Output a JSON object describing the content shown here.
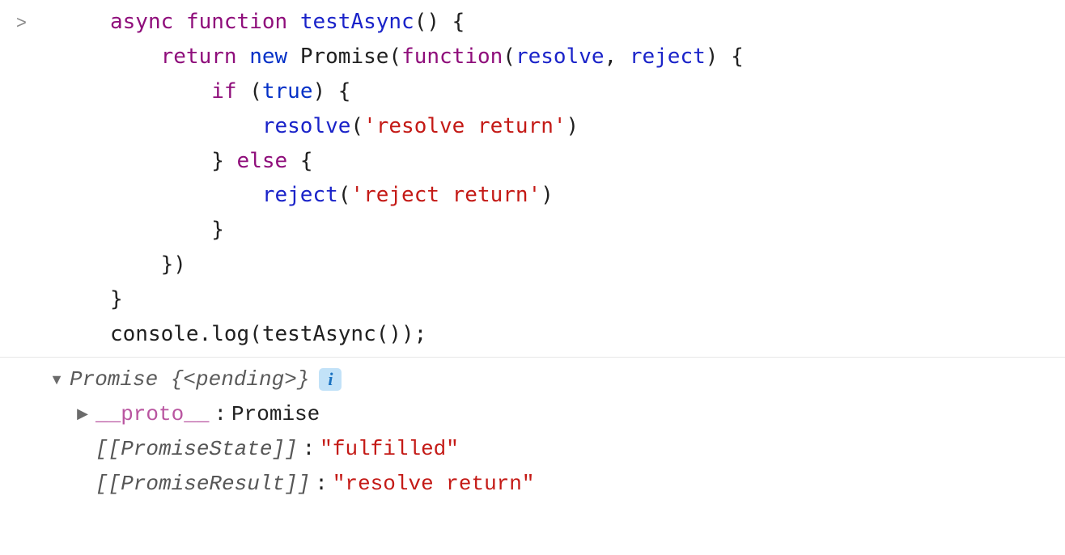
{
  "prompt": ">",
  "code": {
    "l1": {
      "async_kw": "async",
      "function_kw": "function",
      "name": "testAsync",
      "after": "() {"
    },
    "l2": {
      "return_kw": "return",
      "new_kw": "new",
      "promise": "Promise(",
      "function_kw": "function",
      "args_open": "(",
      "resolve": "resolve",
      "reject": "reject",
      "args_close": ") {"
    },
    "l3": {
      "if_kw": "if",
      "cond_open": " (",
      "true_kw": "true",
      "cond_close": ") {"
    },
    "l4": {
      "fn": "resolve",
      "paren_open": "(",
      "str": "'resolve return'",
      "paren_close": ")"
    },
    "l5": {
      "brace": "} ",
      "else_kw": "else",
      "after": " {"
    },
    "l6": {
      "fn": "reject",
      "paren_open": "(",
      "str": "'reject return'",
      "paren_close": ")"
    },
    "l7": "}",
    "l8": "})",
    "l9": "}",
    "l10": "console.log(testAsync());"
  },
  "output": {
    "preview": "Promise {<pending>}",
    "info_icon": "i",
    "proto_key": "__proto__",
    "proto_sep": ": ",
    "proto_val": "Promise",
    "state_key": "[[PromiseState]]",
    "state_sep": ": ",
    "state_val": "\"fulfilled\"",
    "result_key": "[[PromiseResult]]",
    "result_sep": ": ",
    "result_val": "\"resolve return\""
  }
}
